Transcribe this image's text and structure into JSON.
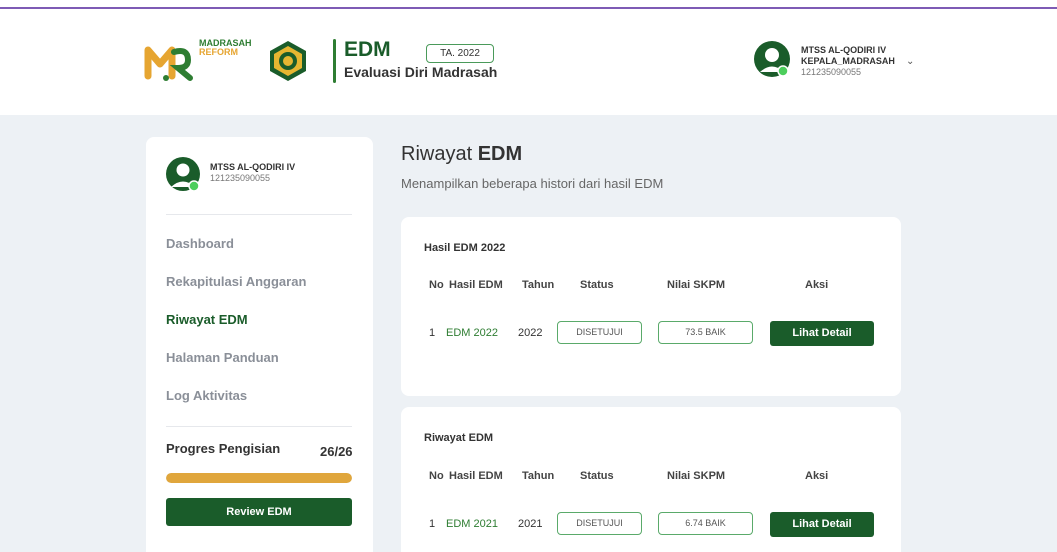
{
  "header": {
    "logo_line1": "MADRASAH",
    "logo_line2": "REFORM",
    "app_short": "EDM",
    "app_full": "Evaluasi Diri Madrasah",
    "year_badge": "TA. 2022",
    "user": {
      "name": "MTSS AL-QODIRI IV",
      "role": "KEPALA_MADRASAH",
      "id": "121235090055"
    }
  },
  "sidebar": {
    "profile": {
      "name": "MTSS AL-QODIRI IV",
      "id": "121235090055"
    },
    "nav": [
      {
        "label": "Dashboard",
        "active": false
      },
      {
        "label": "Rekapitulasi Anggaran",
        "active": false
      },
      {
        "label": "Riwayat EDM",
        "active": true
      },
      {
        "label": "Halaman Panduan",
        "active": false
      },
      {
        "label": "Log Aktivitas",
        "active": false
      }
    ],
    "progress": {
      "label": "Progres Pengisian",
      "count": "26/26",
      "fraction": 1.0
    },
    "review_button": "Review EDM"
  },
  "main": {
    "title_prefix": "Riwayat",
    "title_bold": "EDM",
    "description": "Menampilkan beberapa histori dari hasil EDM",
    "columns": [
      "No",
      "Hasil EDM",
      "Tahun",
      "Status",
      "Nilai SKPM",
      "Aksi"
    ],
    "cards": [
      {
        "title": "Hasil EDM 2022",
        "rows": [
          {
            "no": "1",
            "hasil": "EDM 2022",
            "tahun": "2022",
            "status": "DISETUJUI",
            "nilai": "73.5 BAIK",
            "aksi": "Lihat Detail"
          }
        ]
      },
      {
        "title": "Riwayat EDM",
        "rows": [
          {
            "no": "1",
            "hasil": "EDM 2021",
            "tahun": "2021",
            "status": "DISETUJUI",
            "nilai": "6.74 BAIK",
            "aksi": "Lihat Detail"
          }
        ]
      }
    ]
  },
  "colors": {
    "brand_green": "#1a5c2a",
    "accent_purple": "#7e5bb5",
    "progress_orange": "#e0a63c"
  }
}
